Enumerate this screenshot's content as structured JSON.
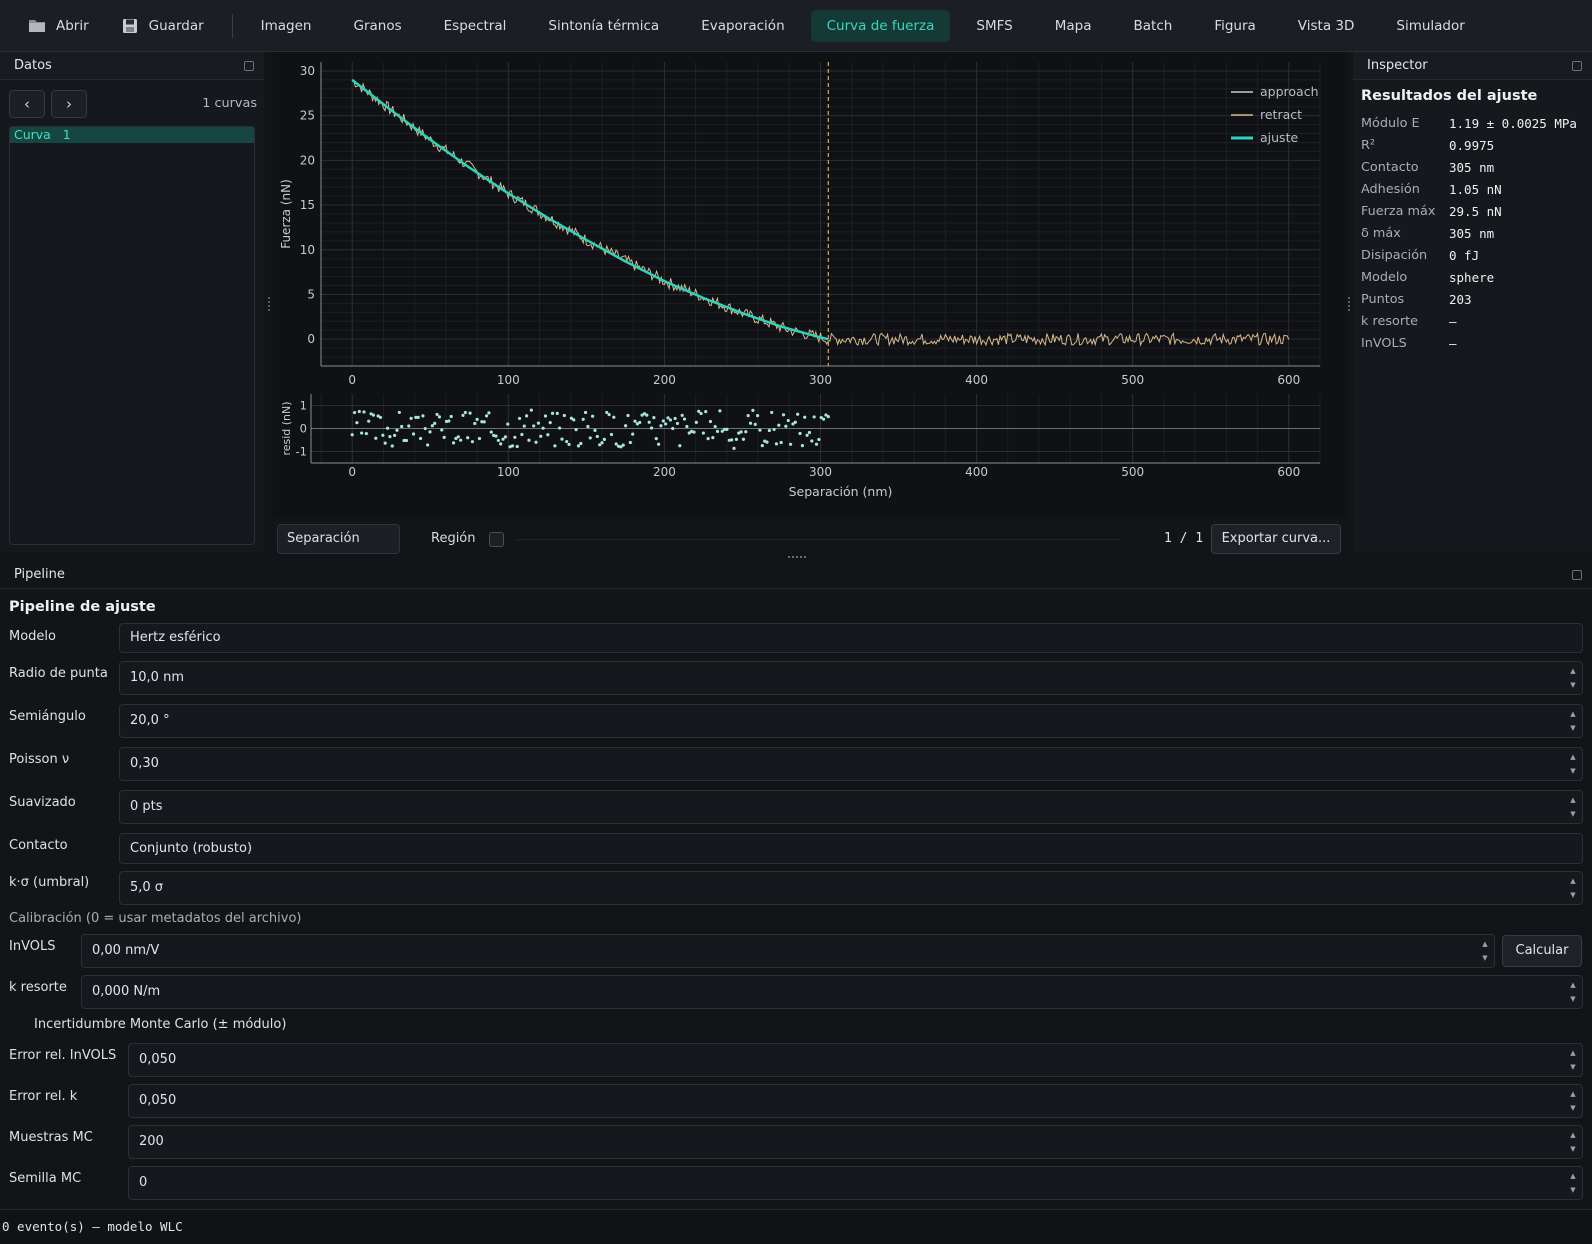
{
  "toolbar": {
    "open_label": "Abrir",
    "save_label": "Guardar",
    "tabs": [
      "Imagen",
      "Granos",
      "Espectral",
      "Sintonía térmica",
      "Evaporación",
      "Curva de fuerza",
      "SMFS",
      "Mapa",
      "Batch",
      "Figura",
      "Vista 3D",
      "Simulador"
    ],
    "active_tab": "Curva de fuerza"
  },
  "datos": {
    "title": "Datos",
    "prev_label": "‹",
    "next_label": "›",
    "count_label": "1 curvas",
    "curves": [
      {
        "name": "Curva",
        "index": "1"
      }
    ]
  },
  "plot_controls": {
    "x_axis_select": "Separación",
    "region_label": "Región",
    "region_checked": false,
    "page_indicator": "1 / 1",
    "export_label": "Exportar curva..."
  },
  "chart_data": [
    {
      "type": "line",
      "ylabel": "Fuerza (nN)",
      "xlim": [
        -20,
        620
      ],
      "ylim": [
        -3,
        31
      ],
      "xticks": [
        0,
        100,
        200,
        300,
        400,
        500,
        600
      ],
      "yticks": [
        0,
        5,
        10,
        15,
        20,
        25,
        30
      ],
      "grid": true,
      "legend_position": "top-right",
      "contact_marker_x": 305,
      "series": [
        {
          "name": "approach",
          "color": "#c8ccd2",
          "x": [],
          "y": []
        },
        {
          "name": "retract",
          "color": "#d9b88a",
          "x": [
            0,
            25,
            50,
            100,
            150,
            200,
            250,
            280,
            305,
            350,
            400,
            450,
            500,
            550,
            600
          ],
          "y": [
            29.0,
            25.6,
            22.3,
            16.3,
            11.1,
            6.5,
            2.9,
            1.0,
            0.0,
            0.0,
            0.0,
            0.0,
            0.0,
            0.0,
            0.0
          ]
        },
        {
          "name": "ajuste",
          "color": "#2ed3bd",
          "x": [
            0,
            25,
            50,
            75,
            100,
            125,
            150,
            175,
            200,
            225,
            250,
            275,
            300,
            305
          ],
          "y": [
            29.0,
            25.6,
            22.3,
            19.2,
            16.3,
            13.6,
            11.1,
            8.7,
            6.5,
            4.6,
            2.9,
            1.4,
            0.2,
            0.0
          ]
        }
      ]
    },
    {
      "type": "scatter",
      "xlabel": "Separación (nm)",
      "ylabel": "resid (nN)",
      "xlim": [
        -20,
        620
      ],
      "ylim": [
        -1.5,
        1.5
      ],
      "xticks": [
        0,
        100,
        200,
        300,
        400,
        500,
        600
      ],
      "yticks": [
        1,
        0,
        -1
      ],
      "grid": true,
      "series": [
        {
          "name": "",
          "color": "#a8e6dc",
          "x_range": [
            0,
            305
          ],
          "points": 203,
          "y_range": [
            -1.1,
            1.3
          ]
        }
      ]
    }
  ],
  "inspector": {
    "title": "Inspector",
    "heading": "Resultados del ajuste",
    "rows": [
      {
        "key": "Módulo E",
        "value": "1.19 ± 0.0025 MPa"
      },
      {
        "key": "R²",
        "value": "0.9975"
      },
      {
        "key": "Contacto",
        "value": "305 nm"
      },
      {
        "key": "Adhesión",
        "value": "1.05 nN"
      },
      {
        "key": "Fuerza máx",
        "value": "29.5 nN"
      },
      {
        "key": "δ máx",
        "value": "305 nm"
      },
      {
        "key": "Disipación",
        "value": "0 fJ"
      },
      {
        "key": "Modelo",
        "value": "sphere"
      },
      {
        "key": "Puntos",
        "value": "203"
      },
      {
        "key": "k resorte",
        "value": "—"
      },
      {
        "key": "InVOLS",
        "value": "—"
      }
    ]
  },
  "pipeline": {
    "title": "Pipeline",
    "heading": "Pipeline de ajuste",
    "model_label": "Modelo",
    "model_value": "Hertz esférico",
    "tip_radius_label": "Radio de punta",
    "tip_radius_value": "10,0 nm",
    "half_angle_label": "Semiángulo",
    "half_angle_value": "20,0 °",
    "poisson_label": "Poisson ν",
    "poisson_value": "0,30",
    "smoothing_label": "Suavizado",
    "smoothing_value": "0 pts",
    "contact_label": "Contacto",
    "contact_value": "Conjunto (robusto)",
    "ksigma_label": "k·σ (umbral)",
    "ksigma_value": "5,0 σ",
    "calibration_label": "Calibración (0 = usar metadatos del archivo)",
    "invols_label": "InVOLS",
    "invols_value": "0,00 nm/V",
    "calc_label": "Calcular",
    "spring_label": "k resorte",
    "spring_value": "0,000 N/m",
    "mc_label": "Incertidumbre Monte Carlo (± módulo)",
    "mc_checked": false,
    "err_invols_label": "Error rel. InVOLS",
    "err_invols_value": "0,050",
    "err_k_label": "Error rel. k",
    "err_k_value": "0,050",
    "mc_samples_label": "Muestras MC",
    "mc_samples_value": "200",
    "mc_seed_label": "Semilla MC",
    "mc_seed_value": "0"
  },
  "status": "0 evento(s) — modelo WLC"
}
